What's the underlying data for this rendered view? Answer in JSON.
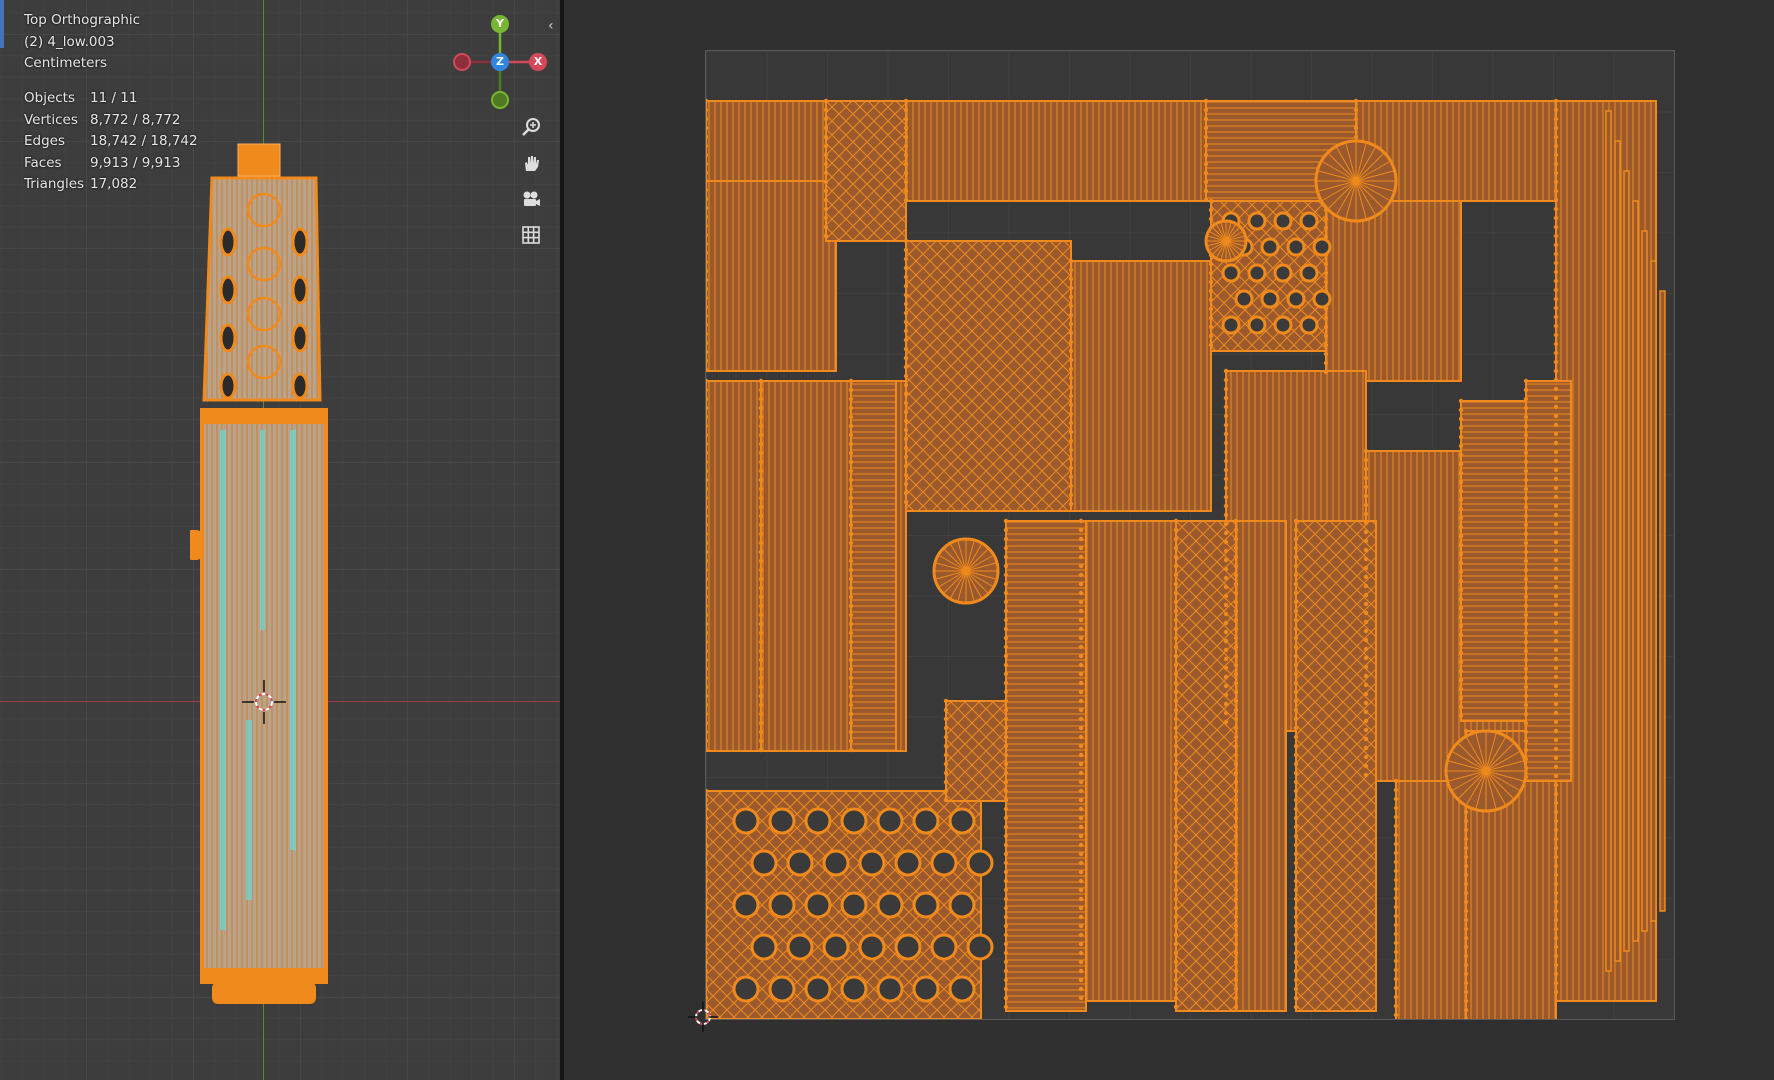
{
  "viewport": {
    "view_name": "Top Orthographic",
    "object_name": "(2) 4_low.003",
    "units": "Centimeters",
    "stats": [
      {
        "label": "Objects",
        "value": "11 / 11"
      },
      {
        "label": "Vertices",
        "value": "8,772 / 8,772"
      },
      {
        "label": "Edges",
        "value": "18,742 / 18,742"
      },
      {
        "label": "Faces",
        "value": "9,913 / 9,913"
      },
      {
        "label": "Triangles",
        "value": "17,082"
      }
    ],
    "gizmo": {
      "y": "Y",
      "z": "Z",
      "x": "X"
    },
    "nav_icons": [
      "zoom-icon",
      "hand-pan-icon",
      "camera-icon",
      "grid-icon"
    ]
  },
  "colors": {
    "accent_orange": "#f08a1c",
    "face_orange": "#9a5a2e",
    "axis_x": "#d3495a",
    "axis_y": "#77b631",
    "axis_z": "#2f86e0",
    "active_blue": "#4772b3"
  }
}
